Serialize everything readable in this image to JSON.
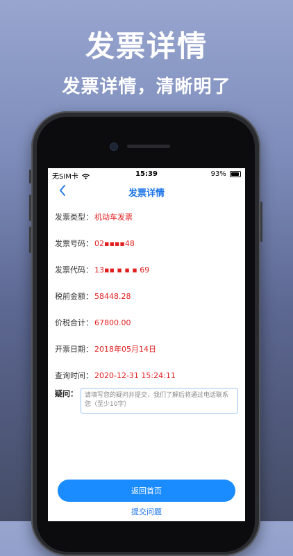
{
  "promo": {
    "title": "发票详情",
    "subtitle": "发票详情，清晰明了"
  },
  "status_bar": {
    "carrier": "无SIM卡",
    "time": "15:39",
    "battery": "93%"
  },
  "nav": {
    "title": "发票详情"
  },
  "details": [
    {
      "label": "发票类型：",
      "value": "机动车发票"
    },
    {
      "label": "发票号码：",
      "value": "02▪▪▪▪48"
    },
    {
      "label": "发票代码：",
      "value": "13▪▪ ▪ ▪ ▪ 69"
    },
    {
      "label": "税前金额：",
      "value": "58448.28"
    },
    {
      "label": "价税合计：",
      "value": "67800.00"
    },
    {
      "label": "开票日期：",
      "value": "2018年05月14日"
    },
    {
      "label": "查询时间：",
      "value": "2020-12-31 15:24:11"
    }
  ],
  "question": {
    "label": "疑问：",
    "placeholder": "请填写您的疑问并提交，我们了解后将通过电话联系您（至少10字）"
  },
  "actions": {
    "home_label": "返回首页",
    "submit_label": "提交问题"
  },
  "colors": {
    "accent": "#1a8cff",
    "value_red": "#e02020",
    "title_blue": "#1a73e8"
  }
}
